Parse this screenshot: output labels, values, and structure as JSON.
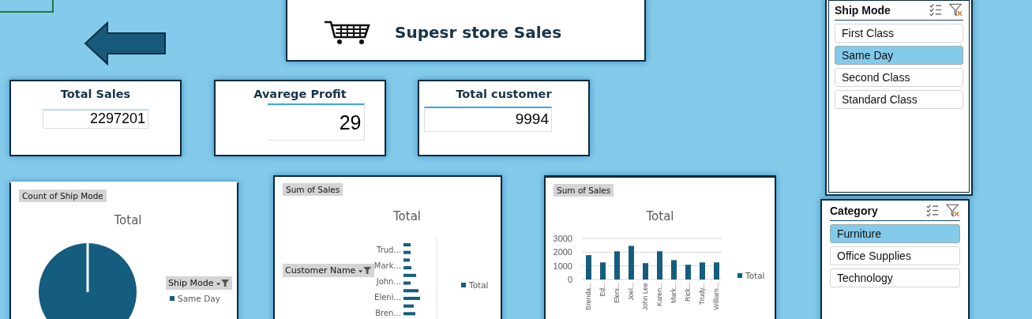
{
  "title_card": {
    "title": "Supesr store Sales"
  },
  "kpis": [
    {
      "label": "Total Sales",
      "value": "2297201"
    },
    {
      "label": "Avarege Profit",
      "value": "29"
    },
    {
      "label": "Total customer",
      "value": "9994"
    }
  ],
  "pie_card": {
    "field_button": "Count of Ship Mode",
    "title": "Total",
    "legend_field": "Ship Mode",
    "legend_items": [
      "Same Day"
    ]
  },
  "bar_card": {
    "field_button": "Sum of Sales",
    "title": "Total",
    "axis_field": "Customer Name",
    "category_labels": [
      "Trud...",
      "Mark...",
      "John...",
      "Eleni...",
      "Bren..."
    ],
    "legend": "Total"
  },
  "column_card": {
    "field_button": "Sum of Sales",
    "chart_data": {
      "type": "bar",
      "title": "Total",
      "categories": [
        "Brenda...",
        "Ed...",
        "Eleni...",
        "Joel...",
        "John Lee",
        "Karen...",
        "Mark...",
        "Rick...",
        "Trudy...",
        "William..."
      ],
      "series": [
        {
          "name": "Total",
          "color": "#155d7e",
          "values": [
            1780,
            1250,
            2060,
            2460,
            1200,
            2060,
            1420,
            1080,
            1250,
            1250
          ]
        }
      ],
      "ylim": [
        0,
        3000
      ],
      "yticks": [
        0,
        1000,
        2000,
        3000
      ]
    }
  },
  "slicers": [
    {
      "title": "Ship Mode",
      "items": [
        {
          "label": "First Class",
          "selected": false
        },
        {
          "label": "Same Day",
          "selected": true
        },
        {
          "label": "Second Class",
          "selected": false
        },
        {
          "label": "Standard Class",
          "selected": false
        }
      ]
    },
    {
      "title": "Category",
      "items": [
        {
          "label": "Furniture",
          "selected": true
        },
        {
          "label": "Office Supplies",
          "selected": false
        },
        {
          "label": "Technology",
          "selected": false
        }
      ]
    }
  ]
}
